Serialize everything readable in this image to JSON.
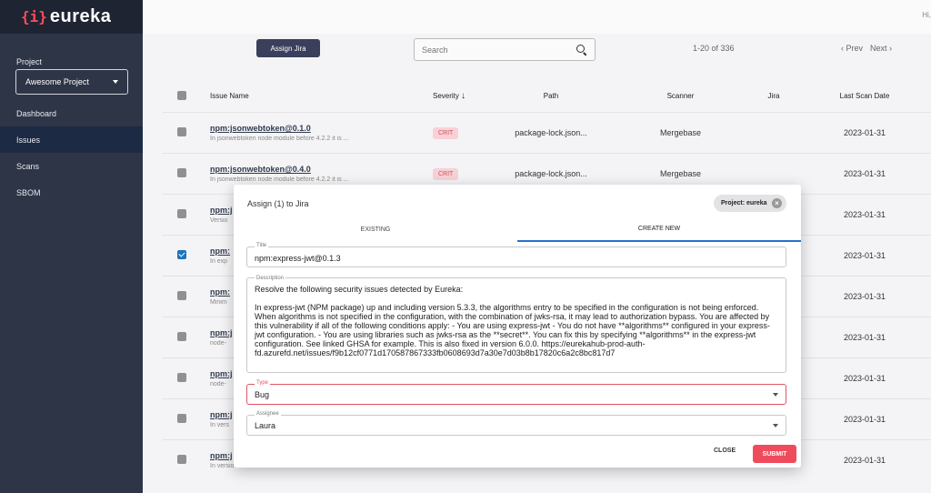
{
  "logo": {
    "mark": "{i}",
    "text": "eureka"
  },
  "sidebar": {
    "project_label": "Project",
    "project_value": "Awesome Project",
    "items": [
      {
        "label": "Dashboard",
        "active": false
      },
      {
        "label": "Issues",
        "active": true
      },
      {
        "label": "Scans",
        "active": false
      },
      {
        "label": "SBOM",
        "active": false
      }
    ]
  },
  "topbar": {
    "greeting": "Hi,"
  },
  "toolbar": {
    "assign_label": "Assign Jira",
    "search_placeholder": "Search",
    "page_count": "1-20 of 336",
    "prev_label": "‹ Prev",
    "next_label": "Next ›"
  },
  "table": {
    "headers": {
      "name": "Issue Name",
      "severity": "Severity",
      "path": "Path",
      "scanner": "Scanner",
      "jira": "Jira",
      "date": "Last Scan Date"
    },
    "rows": [
      {
        "title": "npm:jsonwebtoken@0.1.0",
        "desc": "In jsonwebtoken node module before 4.2.2 it is ...",
        "severity": "CRIT",
        "path": "package-lock.json...",
        "scanner": "Mergebase",
        "date": "2023-01-31",
        "checked": false
      },
      {
        "title": "npm:jsonwebtoken@0.4.0",
        "desc": "In jsonwebtoken node module before 4.2.2 it is ...",
        "severity": "CRIT",
        "path": "package-lock.json...",
        "scanner": "Mergebase",
        "date": "2023-01-31",
        "checked": false
      },
      {
        "title": "npm:j",
        "desc": "Versio",
        "severity": "",
        "path": "",
        "scanner": "",
        "date": "2023-01-31",
        "checked": false
      },
      {
        "title": "npm:",
        "desc": "In exp",
        "severity": "",
        "path": "",
        "scanner": "",
        "date": "2023-01-31",
        "checked": true
      },
      {
        "title": "npm:",
        "desc": "Minim",
        "severity": "",
        "path": "",
        "scanner": "",
        "date": "2023-01-31",
        "checked": false
      },
      {
        "title": "npm:j",
        "desc": "node-",
        "severity": "",
        "path": "",
        "scanner": "",
        "date": "2023-01-31",
        "checked": false
      },
      {
        "title": "npm:j",
        "desc": "node-",
        "severity": "",
        "path": "",
        "scanner": "",
        "date": "2023-01-31",
        "checked": false
      },
      {
        "title": "npm:j",
        "desc": "In vers",
        "severity": "",
        "path": "",
        "scanner": "",
        "date": "2023-01-31",
        "checked": false
      },
      {
        "title": "npm:j",
        "desc": "In versions",
        "severity": "",
        "path": "",
        "scanner": "",
        "date": "2023-01-31",
        "checked": false
      }
    ]
  },
  "modal": {
    "title": "Assign (1) to Jira",
    "chip": "Project: eureka",
    "tab_existing": "EXISTING",
    "tab_create": "CREATE NEW",
    "title_label": "Title",
    "title_value": "npm:express-jwt@0.1.3",
    "desc_label": "Description",
    "desc_line1": "Resolve the following security issues detected by Eureka:",
    "desc_line2": "In express-jwt (NPM package) up and including version 5.3.3, the algorithms entry to be specified in the configuration is not being enforced. When algorithms is not specified in the configuration, with the combination of jwks-rsa, it may lead to authorization bypass. You are affected by this vulnerability if all of the following conditions apply: - You are using express-jwt - You do not have **algorithms** configured in your express-jwt configuration. - You are using libraries such as jwks-rsa as the **secret**. You can fix this by specifying **algorithms** in the express-jwt configuration. See linked GHSA for example. This is also fixed in version 6.0.0. https://eurekahub-prod-auth-fd.azurefd.net/issues/f9b12cf0771d170587867333fb0608693d7a30e7d03b8b17820c6a2c8bc817d7",
    "type_label": "Type",
    "type_value": "Bug",
    "assignee_label": "Assignee",
    "assignee_value": "Laura",
    "close_label": "CLOSE",
    "submit_label": "SUBMIT"
  }
}
